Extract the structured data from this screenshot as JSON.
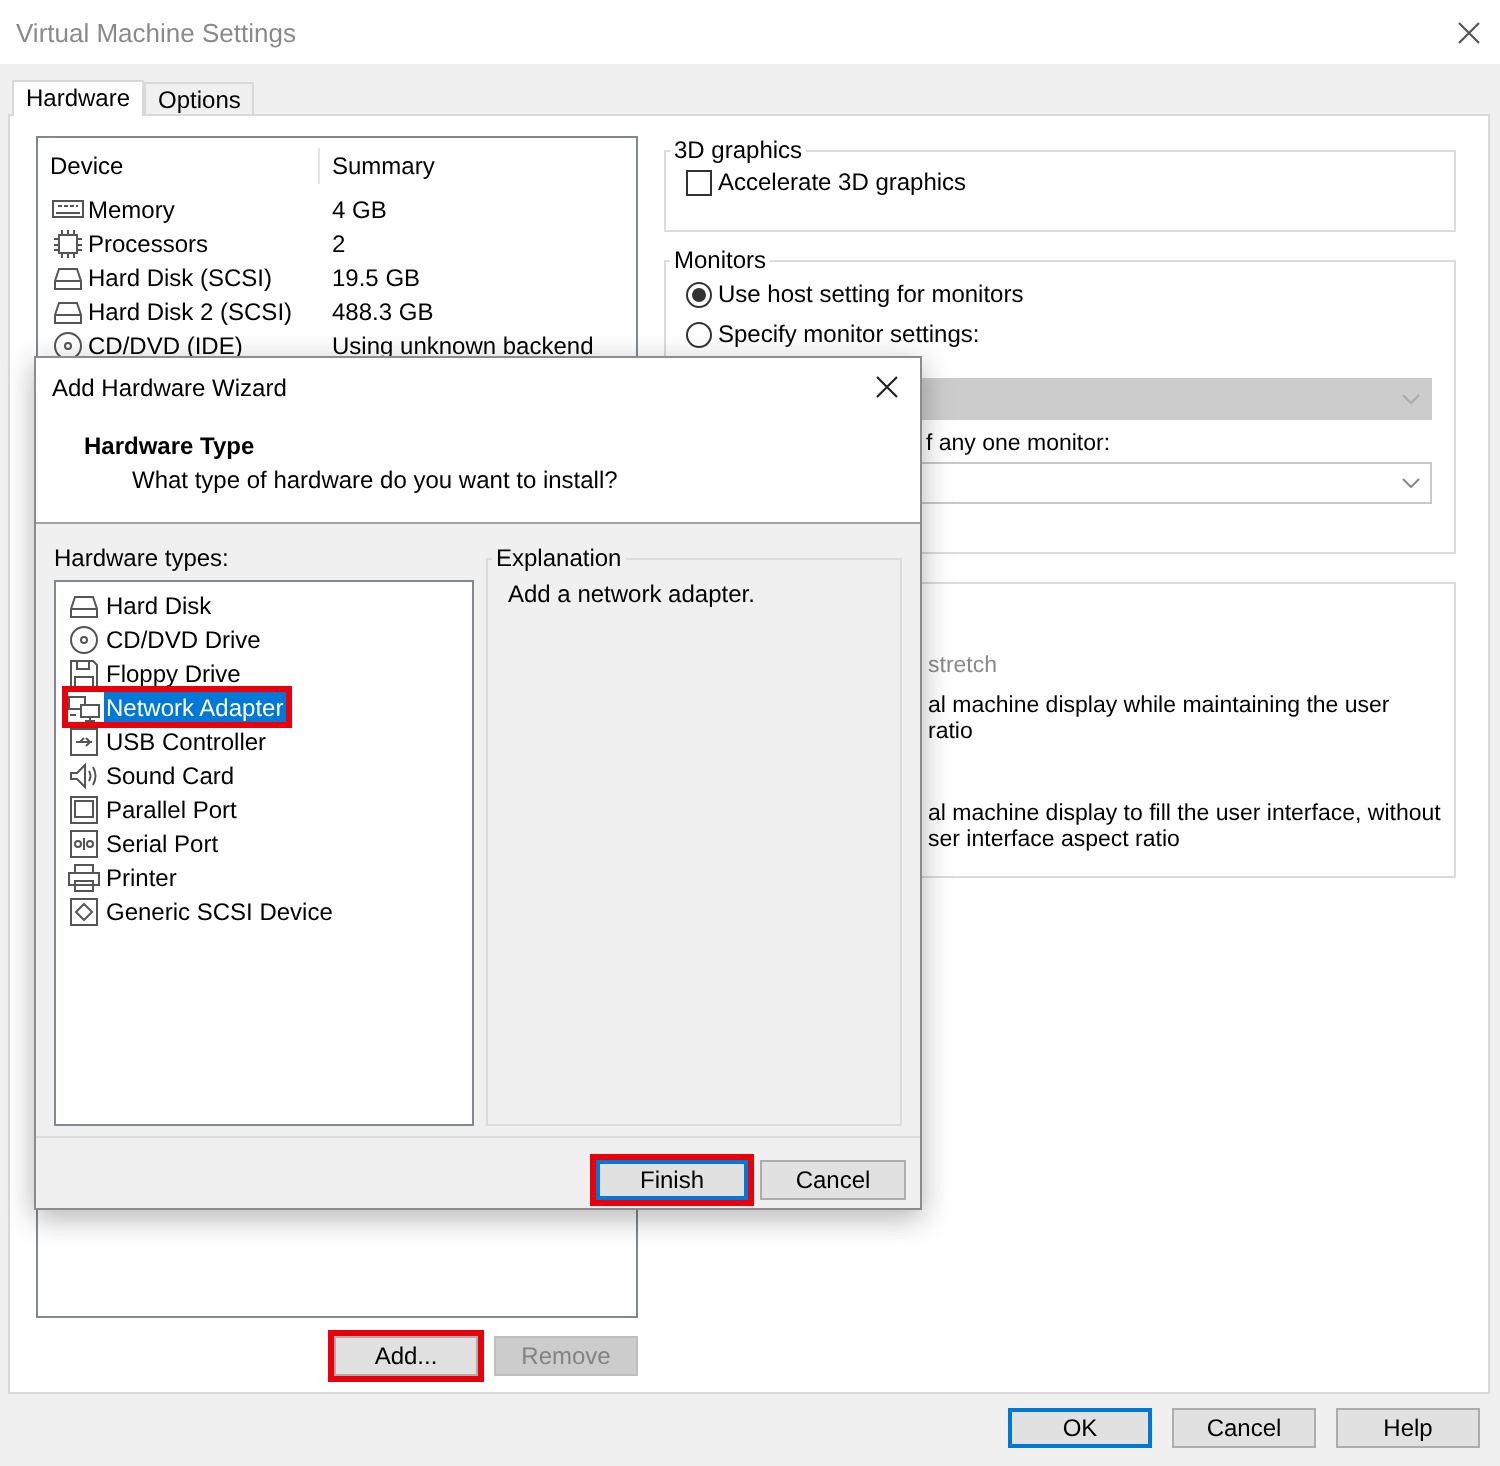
{
  "window": {
    "title": "Virtual Machine Settings"
  },
  "tabs": [
    {
      "label": "Hardware",
      "selected": true
    },
    {
      "label": "Options",
      "selected": false
    }
  ],
  "devices": {
    "columns": [
      "Device",
      "Summary"
    ],
    "rows": [
      {
        "kind": "memory",
        "name": "Memory",
        "summary": "4 GB"
      },
      {
        "kind": "cpu",
        "name": "Processors",
        "summary": "2"
      },
      {
        "kind": "disk",
        "name": "Hard Disk (SCSI)",
        "summary": "19.5 GB"
      },
      {
        "kind": "disk",
        "name": "Hard Disk 2 (SCSI)",
        "summary": "488.3 GB"
      },
      {
        "kind": "cd",
        "name": "CD/DVD (IDE)",
        "summary": "Using unknown backend"
      }
    ]
  },
  "device_buttons": [
    {
      "label": "Add...",
      "disabled": false,
      "annotated": true
    },
    {
      "label": "Remove",
      "disabled": true,
      "annotated": false
    }
  ],
  "graphics": {
    "legend": "3D graphics",
    "accelerate": {
      "label": "Accelerate 3D graphics",
      "checked": false
    }
  },
  "monitors": {
    "legend": "Monitors",
    "options": [
      {
        "label": "Use host setting for monitors",
        "selected": true
      },
      {
        "label": "Specify monitor settings:",
        "selected": false
      }
    ],
    "dropdowns": [
      {
        "disabled": true
      },
      {
        "disabled": false
      }
    ],
    "resolution_label": "f any one monitor:"
  },
  "scaling": {
    "option": {
      "label": "stretch",
      "disabled": true
    },
    "descriptions": [
      [
        "al machine display while maintaining the user",
        "ratio"
      ],
      [
        "al machine display to fill the user interface, without",
        "ser interface aspect ratio"
      ]
    ]
  },
  "footer_buttons": [
    {
      "label": "OK",
      "default": true
    },
    {
      "label": "Cancel",
      "default": false
    },
    {
      "label": "Help",
      "default": false
    }
  ],
  "wizard": {
    "title": "Add Hardware Wizard",
    "heading": "Hardware Type",
    "subtitle": "What type of hardware do you want to install?",
    "list_label": "Hardware types:",
    "items": [
      {
        "kind": "disk",
        "label": "Hard Disk",
        "selected": false,
        "annotated": false
      },
      {
        "kind": "cd",
        "label": "CD/DVD Drive",
        "selected": false,
        "annotated": false
      },
      {
        "kind": "floppy",
        "label": "Floppy Drive",
        "selected": false,
        "annotated": false
      },
      {
        "kind": "network",
        "label": "Network Adapter",
        "selected": true,
        "annotated": true
      },
      {
        "kind": "usb",
        "label": "USB Controller",
        "selected": false,
        "annotated": false
      },
      {
        "kind": "sound",
        "label": "Sound Card",
        "selected": false,
        "annotated": false
      },
      {
        "kind": "parallel",
        "label": "Parallel Port",
        "selected": false,
        "annotated": false
      },
      {
        "kind": "serial",
        "label": "Serial Port",
        "selected": false,
        "annotated": false
      },
      {
        "kind": "printer",
        "label": "Printer",
        "selected": false,
        "annotated": false
      },
      {
        "kind": "scsi",
        "label": "Generic SCSI Device",
        "selected": false,
        "annotated": false
      }
    ],
    "explanation": {
      "legend": "Explanation",
      "text": "Add a network adapter."
    },
    "buttons": [
      {
        "label": "Finish",
        "default": true,
        "annotated": true
      },
      {
        "label": "Cancel",
        "default": false,
        "annotated": false
      }
    ]
  }
}
